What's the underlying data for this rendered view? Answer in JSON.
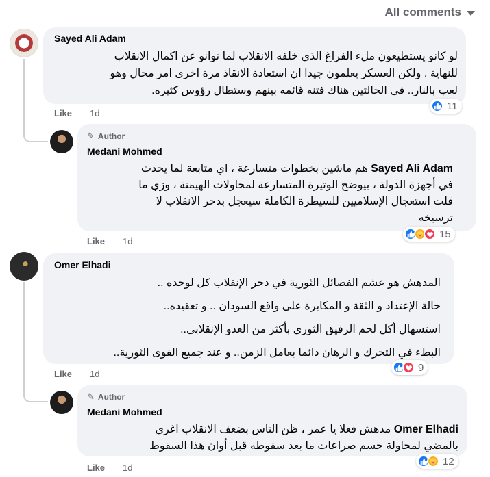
{
  "header": {
    "filter_label": "All comments"
  },
  "comments": [
    {
      "author": "Sayed Ali Adam",
      "lines": [
        "لو كانو يستطيعون ملء الفراغ الذي خلفه الانقلاب لما توانو عن اكمال الانقلاب",
        "للنهاية . ولكن العسكر يعلمون جيدا ان استعادة الانقاذ مرة اخرى امر محال وهو",
        "لعب بالنار.. في الحالتين هناك فتنه قائمه بينهم وستطال رؤوس كثيره."
      ],
      "like_label": "Like",
      "time": "1d",
      "reaction_count": "11",
      "reaction_icons": [
        "like-icon"
      ]
    },
    {
      "author": "Medani Mohmed",
      "badge": "Author",
      "mention": "Sayed Ali Adam",
      "first_line_rest": " هم ماشين بخطوات متسارعة ، اي متابعة لما يحدث",
      "lines": [
        "في أجهزة الدولة ، بيوضح الوتيرة المتسارعة لمحاولات الهيمنة ، وزي ما",
        "قلت استعجال الإسلاميين للسيطرة الكاملة سيعجل بدحر الانقلاب لا",
        "ترسيخه"
      ],
      "like_label": "Like",
      "time": "1d",
      "reaction_count": "15",
      "reaction_icons": [
        "like-icon",
        "care-icon",
        "love-icon"
      ]
    },
    {
      "author": "Omer Elhadi",
      "lines": [
        "المدهش هو عشم الفصائل الثورية في دحر الإنقلاب كل لوحده ..",
        "حالة الإعتداد و الثقة و المكابرة على واقع السودان .. و تعقيده..",
        "استسهال أكل لحم الرفيق الثوري بأكثر من العدو الإنقلابي..",
        "البطء في التحرك و الرهان دائما بعامل الزمن.. و عند جميع القوى الثورية.."
      ],
      "like_label": "Like",
      "time": "1d",
      "reaction_count": "9",
      "reaction_icons": [
        "like-icon",
        "love-icon"
      ]
    },
    {
      "author": "Medani Mohmed",
      "badge": "Author",
      "mention": "Omer Elhadi",
      "first_line_rest": " مدهش فعلا يا عمر ، ظن الناس بضعف الانقلاب اغري",
      "lines": [
        "بالمضي لمحاولة حسم صراعات ما بعد سقوطه قبل أوان هذا السقوط"
      ],
      "like_label": "Like",
      "time": "1d",
      "reaction_count": "12",
      "reaction_icons": [
        "like-icon",
        "care-icon"
      ]
    }
  ]
}
